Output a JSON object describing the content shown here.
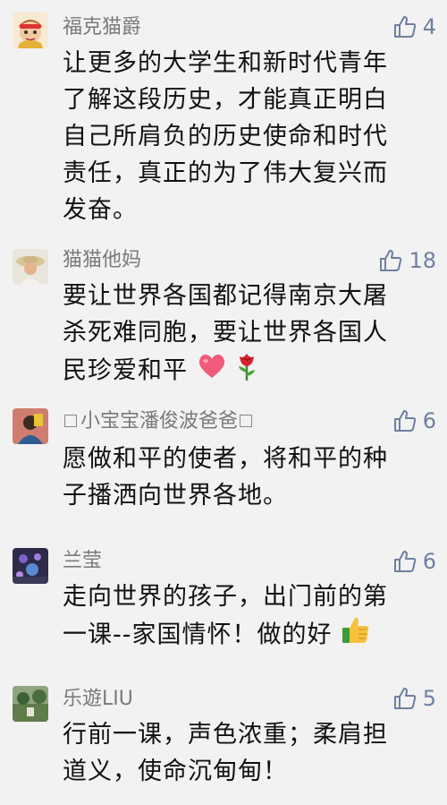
{
  "comments": [
    {
      "name": "福克猫爵",
      "likes": "4",
      "lines": [
        "让更多的大学生和新时代青年",
        "了解这段历史，才能真正明白",
        "自己所肩负的历史使命和时代",
        "责任，真正的为了伟大复兴而",
        "发奋。"
      ]
    },
    {
      "name": "猫猫他妈",
      "likes": "18",
      "lines": [
        "要让世界各国都记得南京大屠",
        "杀死难同胞，要让世界各国人",
        "民珍爱和平"
      ],
      "emojis": [
        "heart-emoji",
        "rose-emoji"
      ]
    },
    {
      "name": "小宝宝潘俊波爸爸",
      "likes": "6",
      "lines": [
        "愿做和平的使者，将和平的种",
        "子播洒向世界各地。"
      ]
    },
    {
      "name": "兰莹",
      "likes": "6",
      "lines": [
        "走向世界的孩子，出门前的第",
        "一课--家国情怀！做的好"
      ],
      "emojis": [
        "thumbs-up-emoji"
      ]
    },
    {
      "name": "乐遊LIU",
      "likes": "5",
      "lines": [
        "行前一课，声色浓重；柔肩担",
        "道义，使命沉甸甸！"
      ]
    }
  ],
  "colors": {
    "background": "#f2f2f2",
    "name": "#7a7a7a",
    "like": "#6f7fa0",
    "text": "#111111"
  },
  "icons": {
    "like": "thumbs-up-outline-icon"
  }
}
